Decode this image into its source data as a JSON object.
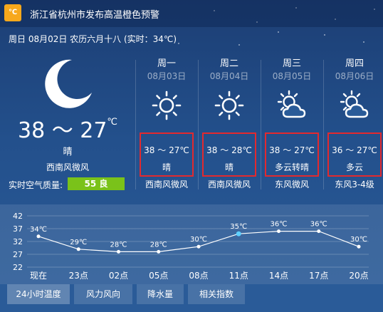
{
  "warning": {
    "icon": "warning-thermometer-icon",
    "icon_text": "℃",
    "icon_color": "#f7a81c",
    "text": "浙江省杭州市发布高温橙色预警"
  },
  "date_line": "周日 08月02日 农历六月十八 (实时：34℃)",
  "today": {
    "icon": "moon-icon",
    "temp_range": "38 ～ 27",
    "temp_unit": "℃",
    "condition": "晴",
    "wind": "西南风微风",
    "air_quality_label": "实时空气质量:",
    "air_quality_value": "55 良",
    "air_quality_color": "#7ac21a"
  },
  "forecast": [
    {
      "day": "周一",
      "date": "08月03日",
      "icon": "sun-icon",
      "temp": "38 ～ 27℃",
      "condition": "晴",
      "wind": "西南风微风"
    },
    {
      "day": "周二",
      "date": "08月04日",
      "icon": "sun-icon",
      "temp": "38 ～ 28℃",
      "condition": "晴",
      "wind": "西南风微风"
    },
    {
      "day": "周三",
      "date": "08月05日",
      "icon": "partly-cloudy-icon",
      "temp": "38 ～ 27℃",
      "condition": "多云转晴",
      "wind": "东风微风"
    },
    {
      "day": "周四",
      "date": "08月06日",
      "icon": "partly-cloudy-icon",
      "temp": "36 ～ 27℃",
      "condition": "多云",
      "wind": "东风3-4级"
    }
  ],
  "highlight_color": "#e3292e",
  "chart_data": {
    "type": "line",
    "x": [
      "现在",
      "23点",
      "02点",
      "05点",
      "08点",
      "11点",
      "14点",
      "17点",
      "20点"
    ],
    "series": [
      {
        "values": [
          34,
          29,
          28,
          28,
          30,
          35,
          36,
          36,
          30
        ]
      }
    ],
    "point_labels": [
      "34℃",
      "29℃",
      "28℃",
      "28℃",
      "30℃",
      "35℃",
      "36℃",
      "36℃",
      "30℃"
    ],
    "y_ticks": [
      "42",
      "37",
      "32",
      "27",
      "22"
    ],
    "ylim": [
      22,
      42
    ],
    "highlight_index": 5,
    "grid": true,
    "line_color": "#ffffff",
    "highlight_color": "#5fd0ff"
  },
  "tabs": [
    "24小时温度",
    "风力风向",
    "降水量",
    "相关指数"
  ],
  "active_tab": 0
}
